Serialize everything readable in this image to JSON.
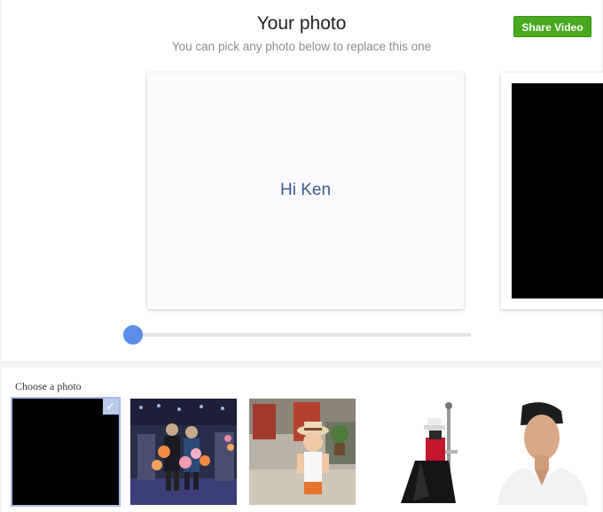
{
  "header": {
    "title": "Your photo",
    "subtitle": "You can pick any photo below to replace this one",
    "share_label": "Share Video"
  },
  "preview": {
    "card_text": "Hi Ken"
  },
  "slider": {
    "position_fraction": 0.0
  },
  "chooser": {
    "label": "Choose a photo",
    "photos": [
      {
        "name": "black-photo",
        "selected": true
      },
      {
        "name": "party-balloons-photo",
        "selected": false
      },
      {
        "name": "child-hat-photo",
        "selected": false
      },
      {
        "name": "anime-character-sword-photo",
        "selected": false
      },
      {
        "name": "man-portrait-photo",
        "selected": false
      }
    ],
    "check_icon": "check-icon"
  },
  "colors": {
    "share_button": "#48a81e",
    "slider_thumb": "#5b8ee8",
    "card_text": "#3b5b8c"
  }
}
